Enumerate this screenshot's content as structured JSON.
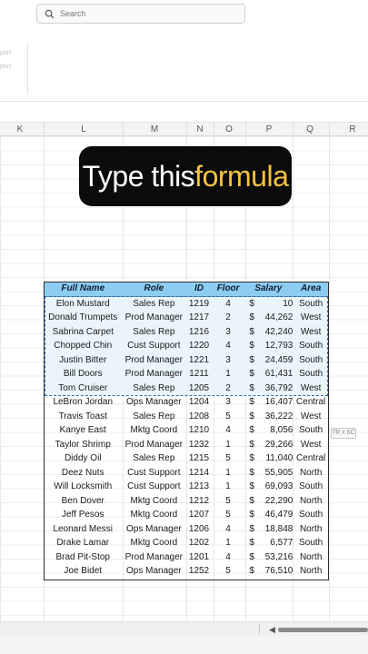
{
  "search": {
    "placeholder": "Search"
  },
  "ribbon": {
    "faint_1": "port",
    "faint_2": "port"
  },
  "columns": [
    "K",
    "L",
    "M",
    "N",
    "O",
    "P",
    "Q",
    "R"
  ],
  "banner": {
    "part1": "Type this ",
    "part2": "formula"
  },
  "table": {
    "headers": [
      "Full Name",
      "Role",
      "ID",
      "Floor",
      "Salary",
      "Area"
    ],
    "rows": [
      [
        "Elon Mustard",
        "Sales Rep",
        "1219",
        "4",
        "$",
        "10",
        "South"
      ],
      [
        "Donald Trumpets",
        "Prod Manager",
        "1217",
        "2",
        "$",
        "44,262",
        "West"
      ],
      [
        "Sabrina Carpet",
        "Sales Rep",
        "1216",
        "3",
        "$",
        "42,240",
        "West"
      ],
      [
        "Chopped Chin",
        "Cust Support",
        "1220",
        "4",
        "$",
        "12,793",
        "South"
      ],
      [
        "Justin Bitter",
        "Prod Manager",
        "1221",
        "3",
        "$",
        "24,459",
        "South"
      ],
      [
        "Bill Doors",
        "Prod Manager",
        "1211",
        "1",
        "$",
        "61,431",
        "South"
      ],
      [
        "Tom Cruiser",
        "Sales Rep",
        "1205",
        "2",
        "$",
        "36,792",
        "West"
      ],
      [
        "LeBron Jordan",
        "Ops Manager",
        "1204",
        "3",
        "$",
        "16,407",
        "Central"
      ],
      [
        "Travis Toast",
        "Sales Rep",
        "1208",
        "5",
        "$",
        "36,222",
        "West"
      ],
      [
        "Kanye East",
        "Mktg Coord",
        "1210",
        "4",
        "$",
        "8,056",
        "South"
      ],
      [
        "Taylor Shrimp",
        "Prod Manager",
        "1232",
        "1",
        "$",
        "29,266",
        "West"
      ],
      [
        "Diddy Oil",
        "Sales Rep",
        "1215",
        "5",
        "$",
        "11,040",
        "Central"
      ],
      [
        "Deez Nuts",
        "Cust Support",
        "1214",
        "1",
        "$",
        "55,905",
        "North"
      ],
      [
        "Will Locksmith",
        "Cust Support",
        "1213",
        "1",
        "$",
        "69,093",
        "South"
      ],
      [
        "Ben Dover",
        "Mktg Coord",
        "1212",
        "5",
        "$",
        "22,290",
        "North"
      ],
      [
        "Jeff Pesos",
        "Mktg Coord",
        "1207",
        "5",
        "$",
        "46,479",
        "South"
      ],
      [
        "Leonard Messi",
        "Ops Manager",
        "1206",
        "4",
        "$",
        "18,848",
        "North"
      ],
      [
        "Drake Lamar",
        "Mktg Coord",
        "1202",
        "1",
        "$",
        "6,577",
        "South"
      ],
      [
        "Brad Pit-Stop",
        "Prod Manager",
        "1201",
        "4",
        "$",
        "53,216",
        "North"
      ],
      [
        "Joe Bidet",
        "Ops Manager",
        "1252",
        "5",
        "$",
        "76,510",
        "North"
      ]
    ],
    "highlighted_rows": 7
  },
  "tooltip": "7R x 6C",
  "colors": {
    "header_bg": "#8ecdf2",
    "selection_border": "#2f6fb0",
    "banner_bg": "#0b0b0b",
    "banner_accent": "#f5c341"
  }
}
